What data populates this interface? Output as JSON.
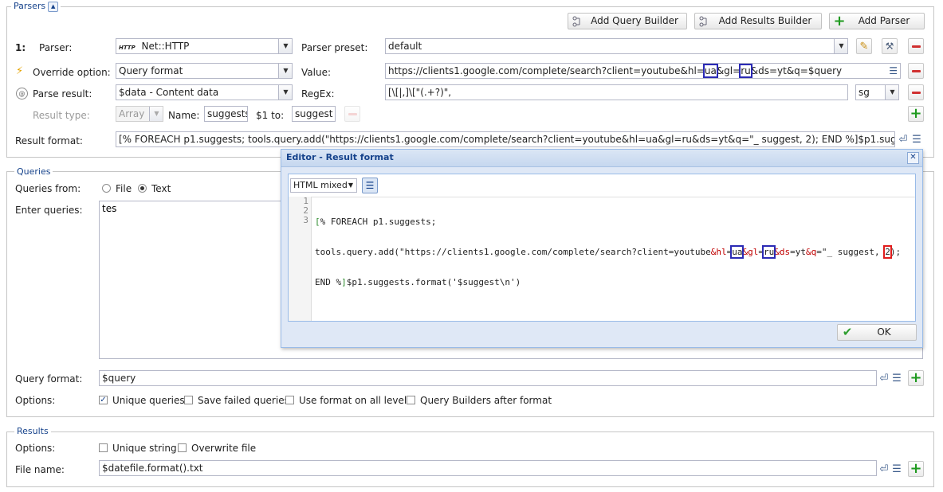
{
  "parsers": {
    "legend": "Parsers",
    "add_query_builder": "Add Query Builder",
    "add_results_builder": "Add Results Builder",
    "add_parser": "Add Parser",
    "index_label": "1:",
    "parser_label": "Parser:",
    "parser_value": "Net::HTTP",
    "parser_icon_text": "HTTP",
    "parser_preset_label": "Parser preset:",
    "parser_preset_value": "default",
    "override_label": "Override option:",
    "override_value": "Query format",
    "value_label": "Value:",
    "value_parts": [
      "https://clients1.google.com/complete/search?client=youtube&hl=",
      "ua",
      "&gl=",
      "ru",
      "&ds=yt&q=$query"
    ],
    "parse_result_label": "Parse result:",
    "parse_result_value": "$data - Content data",
    "regex_label": "RegEx:",
    "regex_value": "[\\[|,]\\[\"(.+?)\",",
    "regex_flag": "sg",
    "result_type_label": "Result type:",
    "result_type_value": "Array",
    "name_label": "Name:",
    "name_value": "suggests",
    "s1to_label": "$1 to:",
    "s1to_value": "suggest",
    "result_format_label": "Result format:",
    "result_format_value": "[% FOREACH p1.suggests; tools.query.add(\"https://clients1.google.com/complete/search?client=youtube&hl=ua&gl=ru&ds=yt&q=\"_ suggest, 2); END %]$p1.suggests.format('$s"
  },
  "queries": {
    "legend": "Queries",
    "from_label": "Queries from:",
    "file_option": "File",
    "text_option": "Text",
    "selected": "Text",
    "enter_label": "Enter queries:",
    "enter_value": "tes",
    "format_label": "Query format:",
    "format_value": "$query",
    "options_label": "Options:",
    "options": [
      {
        "label": "Unique queries",
        "checked": true
      },
      {
        "label": "Save failed queries",
        "checked": false
      },
      {
        "label": "Use format on all levels",
        "checked": false
      },
      {
        "label": "Query Builders after format",
        "checked": false
      }
    ]
  },
  "results": {
    "legend": "Results",
    "options_label": "Options:",
    "options": [
      {
        "label": "Unique string",
        "checked": false
      },
      {
        "label": "Overwrite file",
        "checked": false
      }
    ],
    "filename_label": "File name:",
    "filename_value": "$datefile.format().txt"
  },
  "editor": {
    "title": "Editor - Result format",
    "mode": "HTML mixed",
    "line_numbers": [
      "1",
      "2",
      "3"
    ],
    "ok_label": "OK"
  },
  "colors": {
    "accent": "#15428b",
    "highlight_blue": "#2b2ab5",
    "highlight_red": "#e01c1c",
    "add_green": "#1f9a1f",
    "remove_red": "#d03030"
  }
}
